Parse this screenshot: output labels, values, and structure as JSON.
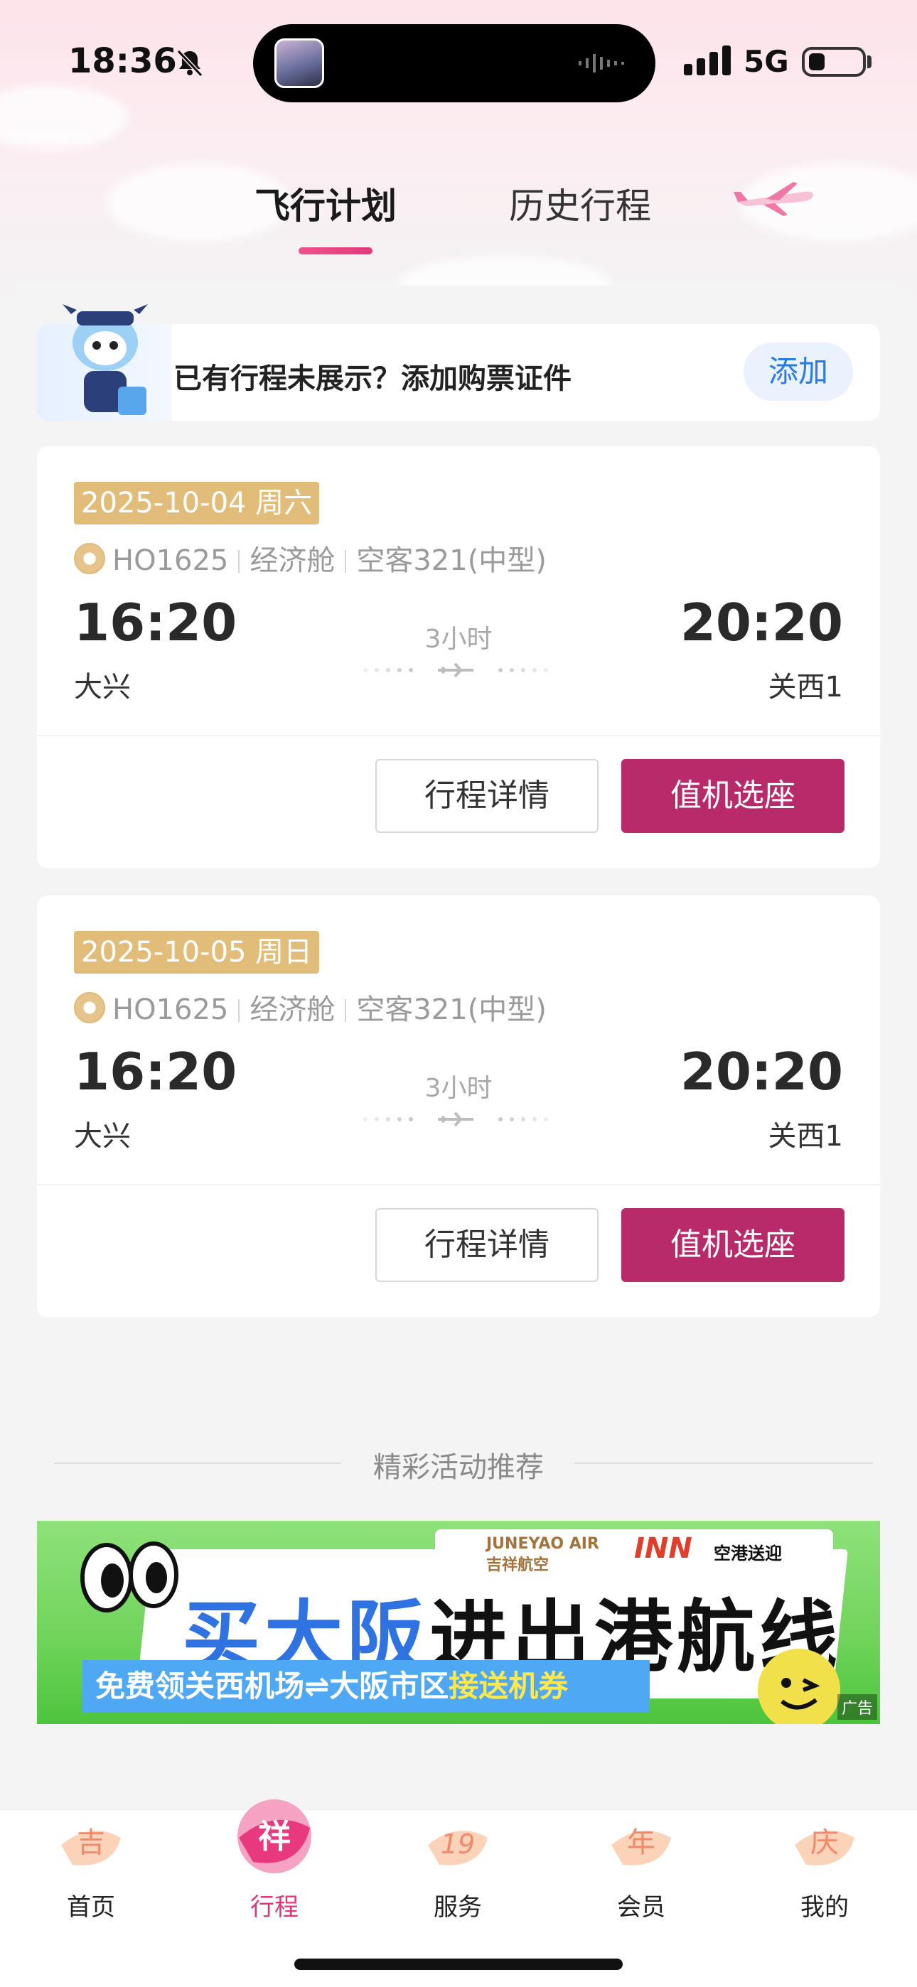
{
  "status_bar": {
    "time": "18:36",
    "network": "5G"
  },
  "tabs": [
    {
      "label": "飞行计划",
      "active": true
    },
    {
      "label": "历史行程",
      "active": false
    }
  ],
  "notice": {
    "text": "已有行程未展示？添加购票证件",
    "button": "添加"
  },
  "flights": [
    {
      "date": "2025-10-04 周六",
      "flight_no": "HO1625",
      "cabin": "经济舱",
      "aircraft": "空客321(中型)",
      "dep_time": "16:20",
      "dep_airport": "大兴",
      "arr_time": "20:20",
      "arr_airport": "关西1",
      "duration": "3小时",
      "detail_button": "行程详情",
      "checkin_button": "值机选座"
    },
    {
      "date": "2025-10-05 周日",
      "flight_no": "HO1625",
      "cabin": "经济舱",
      "aircraft": "空客321(中型)",
      "dep_time": "16:20",
      "dep_airport": "大兴",
      "arr_time": "20:20",
      "arr_airport": "关西1",
      "duration": "3小时",
      "detail_button": "行程详情",
      "checkin_button": "值机选座"
    }
  ],
  "recommend": {
    "title": "精彩活动推荐",
    "banner": {
      "logo_juneyao_en": "JUNEYAO AIR",
      "logo_juneyao_cn": "吉祥航空",
      "logo_partner": "INN",
      "logo_partner_cn": "空港送迎",
      "headline_part1": "买大阪",
      "headline_part2": "进出港航线",
      "sub_part1": "免费领关西机场⇌大阪市区",
      "sub_part2": "接送机券",
      "ad_tag": "广告"
    }
  },
  "bottom_nav": [
    {
      "label": "首页",
      "glyph": "吉",
      "active": false
    },
    {
      "label": "行程",
      "glyph": "祥",
      "active": true
    },
    {
      "label": "服务",
      "glyph": "19",
      "active": false
    },
    {
      "label": "会员",
      "glyph": "年",
      "active": false
    },
    {
      "label": "我的",
      "glyph": "庆",
      "active": false
    }
  ],
  "colors": {
    "accent": "#b82a6a",
    "date_badge": "#e2bd7a",
    "active_tab": "#e0357a"
  },
  "icons": [
    "bell-slash-icon",
    "signal-icon",
    "battery-icon",
    "plane-icon",
    "mascot-icon",
    "airline-logo-icon"
  ]
}
